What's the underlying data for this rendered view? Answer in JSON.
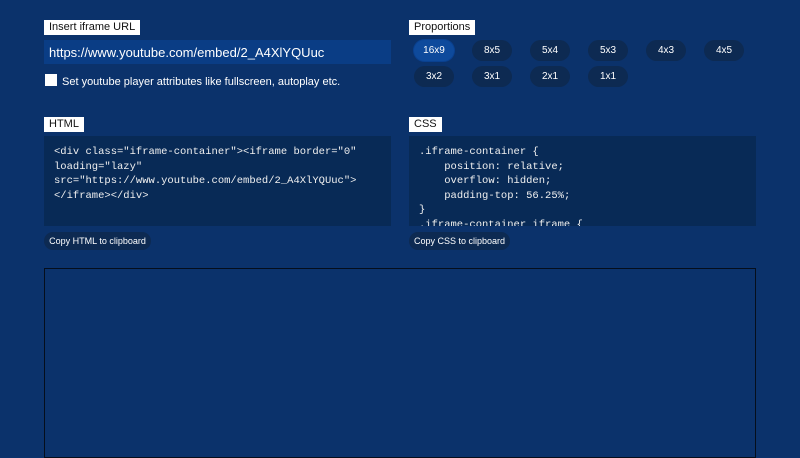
{
  "url_section": {
    "label": "Insert iframe URL",
    "url_value": "https://www.youtube.com/embed/2_A4XlYQUuc",
    "checkbox_label": "Set youtube player attributes like fullscreen, autoplay etc.",
    "checkbox_checked": false
  },
  "proportions": {
    "label": "Proportions",
    "options": [
      "16x9",
      "8x5",
      "5x4",
      "5x3",
      "4x3",
      "4x5",
      "3x2",
      "3x1",
      "2x1",
      "1x1"
    ],
    "selected": "16x9"
  },
  "html_section": {
    "label": "HTML",
    "code": "<div class=\"iframe-container\"><iframe border=\"0\" loading=\"lazy\" src=\"https://www.youtube.com/embed/2_A4XlYQUuc\"></iframe></div>",
    "copy_label": "Copy HTML to clipboard"
  },
  "css_section": {
    "label": "CSS",
    "code": ".iframe-container {\n    position: relative;\n    overflow: hidden;\n    padding-top: 56.25%;\n}\n.iframe-container iframe {",
    "copy_label": "Copy CSS to clipboard"
  },
  "colors": {
    "background": "#0b326b",
    "input_background": "#0a3d85",
    "code_background": "#082a56",
    "pill_background": "#0d2a52",
    "pill_active": "#0e4a9c"
  }
}
